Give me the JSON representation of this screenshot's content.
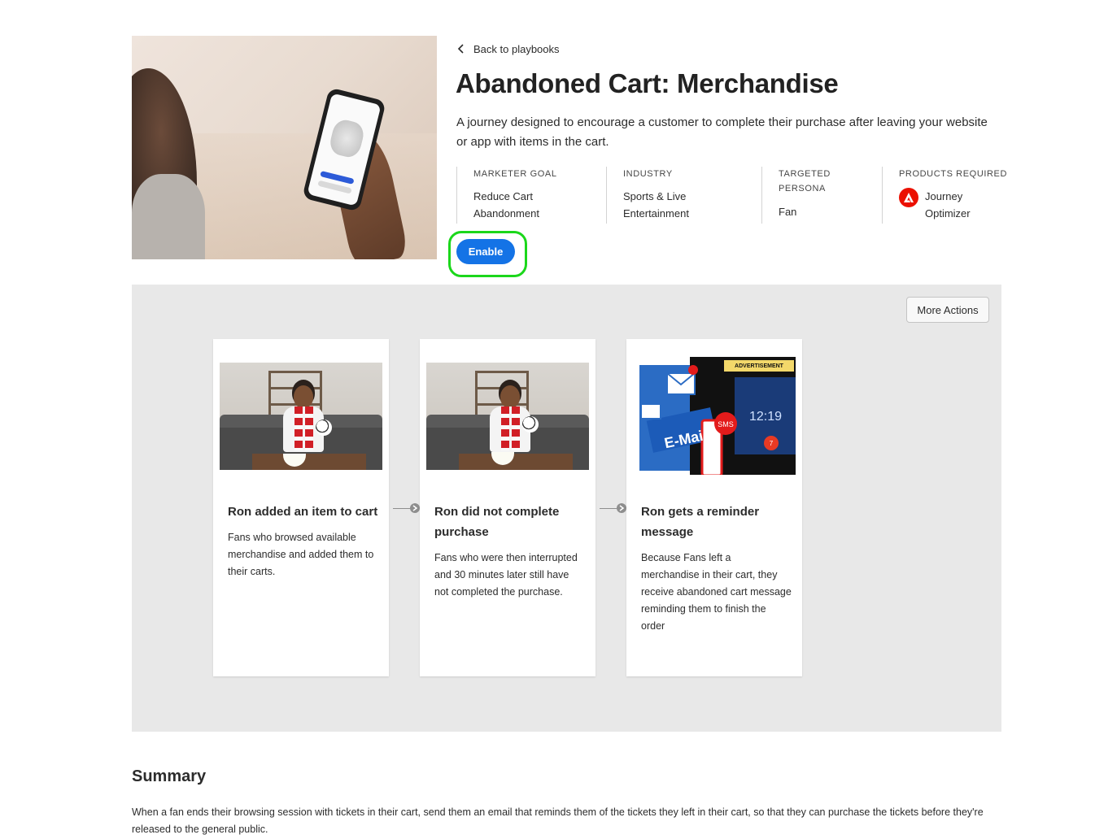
{
  "header": {
    "back_label": "Back to playbooks",
    "title": "Abandoned Cart: Merchandise",
    "description": "A journey designed to encourage a customer to complete their purchase after leaving your website or app with items in the cart."
  },
  "meta": {
    "marketer_goal": {
      "label": "MARKETER GOAL",
      "value_line1": "Reduce Cart",
      "value_line2": "Abandonment"
    },
    "industry": {
      "label": "INDUSTRY",
      "value_line1": "Sports & Live",
      "value_line2": "Entertainment"
    },
    "persona": {
      "label_line1": "TARGETED",
      "label_line2": "PERSONA",
      "value": "Fan"
    },
    "products": {
      "label": "PRODUCTS REQUIRED",
      "value_line1": "Journey",
      "value_line2": "Optimizer"
    }
  },
  "actions": {
    "enable_label": "Enable",
    "more_actions_label": "More Actions"
  },
  "cards": [
    {
      "title": "Ron added an item to cart",
      "text": "Fans who browsed available merchandise and added them to their carts."
    },
    {
      "title": "Ron did not complete purchase",
      "text": "Fans who were then interrupted and 30 minutes later still have not completed the purchase."
    },
    {
      "title": "Ron gets a reminder message",
      "text": "Because Fans left a merchandise in their cart, they receive abandoned cart message reminding them to finish the order",
      "image_text": {
        "ad": "ADVERTISEMENT",
        "email": "E-Mai",
        "sms": "SMS",
        "clock": "12:19",
        "badge": "7"
      }
    }
  ],
  "summary": {
    "heading": "Summary",
    "text": "When a fan ends their browsing session with tickets in their cart, send them an email that reminds them of the tickets they left in their cart, so that they can purchase the tickets before they're released to the general public."
  },
  "colors": {
    "accent": "#1473e6",
    "highlight_ring": "#1bd71b",
    "adobe_red": "#eb1000",
    "canvas_bg": "#e8e8e8"
  }
}
